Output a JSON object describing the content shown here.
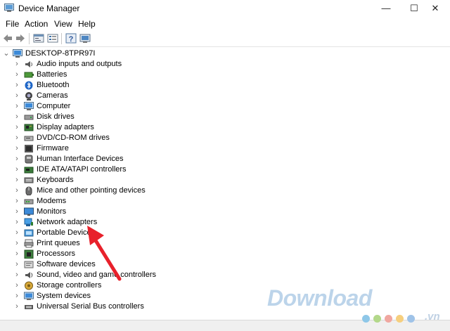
{
  "window": {
    "title": "Device Manager",
    "minimize": "—",
    "maximize": "☐",
    "close": "✕"
  },
  "menu": [
    "File",
    "Action",
    "View",
    "Help"
  ],
  "tree": {
    "root": "DESKTOP-8TPR97I",
    "items": [
      "Audio inputs and outputs",
      "Batteries",
      "Bluetooth",
      "Cameras",
      "Computer",
      "Disk drives",
      "Display adapters",
      "DVD/CD-ROM drives",
      "Firmware",
      "Human Interface Devices",
      "IDE ATA/ATAPI controllers",
      "Keyboards",
      "Mice and other pointing devices",
      "Modems",
      "Monitors",
      "Network adapters",
      "Portable Devices",
      "Print queues",
      "Processors",
      "Software devices",
      "Sound, video and game controllers",
      "Storage controllers",
      "System devices",
      "Universal Serial Bus controllers"
    ],
    "highlighted_item": "Network adapters"
  },
  "watermark": {
    "text": "Download",
    "suffix": ".vn"
  },
  "colors": {
    "annotation_arrow": "#e8212b",
    "watermark": "#bcd4ea"
  }
}
